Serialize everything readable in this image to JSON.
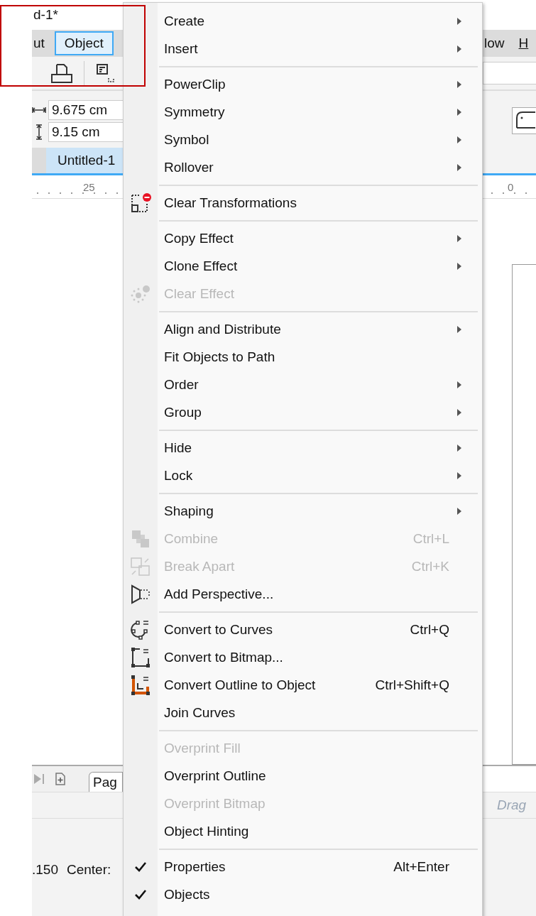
{
  "title_fragment": "d-1*",
  "menubar": {
    "left": [
      {
        "label": "ut",
        "selected": false
      },
      {
        "label": "Object",
        "selected": true
      }
    ],
    "right": [
      {
        "label": "low",
        "selected": false
      },
      {
        "label": "H",
        "selected": false
      }
    ]
  },
  "size_fields": [
    "9.675 cm",
    "9.15 cm"
  ],
  "doc_tabs": [
    {
      "label": "Untitled-1",
      "selected": true
    }
  ],
  "ruler_labels": [
    "25",
    "0"
  ],
  "page_tab": "Pag",
  "hint": "Drag",
  "status": [
    ".150",
    "Center:"
  ],
  "menu": {
    "items": [
      {
        "kind": "item",
        "label": "Create",
        "submenu": true,
        "disabled": false,
        "checked": false
      },
      {
        "kind": "item",
        "label": "Insert",
        "submenu": true,
        "disabled": false,
        "checked": false
      },
      {
        "kind": "separator"
      },
      {
        "kind": "item",
        "label": "PowerClip",
        "submenu": true,
        "disabled": false,
        "checked": false
      },
      {
        "kind": "item",
        "label": "Symmetry",
        "submenu": true,
        "disabled": false,
        "checked": false
      },
      {
        "kind": "item",
        "label": "Symbol",
        "submenu": true,
        "disabled": false,
        "checked": false
      },
      {
        "kind": "item",
        "label": "Rollover",
        "submenu": true,
        "disabled": false,
        "checked": false
      },
      {
        "kind": "separator"
      },
      {
        "kind": "item",
        "label": "Clear Transformations",
        "submenu": false,
        "disabled": false,
        "checked": false
      },
      {
        "kind": "separator"
      },
      {
        "kind": "item",
        "label": "Copy Effect",
        "submenu": true,
        "disabled": false,
        "checked": false
      },
      {
        "kind": "item",
        "label": "Clone Effect",
        "submenu": true,
        "disabled": false,
        "checked": false
      },
      {
        "kind": "item",
        "label": "Clear Effect",
        "submenu": false,
        "disabled": true,
        "checked": false
      },
      {
        "kind": "separator"
      },
      {
        "kind": "item",
        "label": "Align and Distribute",
        "submenu": true,
        "disabled": false,
        "checked": false
      },
      {
        "kind": "item",
        "label": "Fit Objects to Path",
        "submenu": false,
        "disabled": false,
        "checked": false
      },
      {
        "kind": "item",
        "label": "Order",
        "submenu": true,
        "disabled": false,
        "checked": false
      },
      {
        "kind": "item",
        "label": "Group",
        "submenu": true,
        "disabled": false,
        "checked": false
      },
      {
        "kind": "separator"
      },
      {
        "kind": "item",
        "label": "Hide",
        "submenu": true,
        "disabled": false,
        "checked": false
      },
      {
        "kind": "item",
        "label": "Lock",
        "submenu": true,
        "disabled": false,
        "checked": false
      },
      {
        "kind": "separator"
      },
      {
        "kind": "item",
        "label": "Shaping",
        "submenu": true,
        "disabled": false,
        "checked": false
      },
      {
        "kind": "item",
        "label": "Combine",
        "shortcut": "Ctrl+L",
        "submenu": false,
        "disabled": true,
        "checked": false
      },
      {
        "kind": "item",
        "label": "Break Apart",
        "shortcut": "Ctrl+K",
        "submenu": false,
        "disabled": true,
        "checked": false
      },
      {
        "kind": "item",
        "label": "Add Perspective...",
        "submenu": false,
        "disabled": false,
        "checked": false
      },
      {
        "kind": "separator"
      },
      {
        "kind": "item",
        "label": "Convert to Curves",
        "shortcut": "Ctrl+Q",
        "submenu": false,
        "disabled": false,
        "checked": false
      },
      {
        "kind": "item",
        "label": "Convert to Bitmap...",
        "submenu": false,
        "disabled": false,
        "checked": false
      },
      {
        "kind": "item",
        "label": "Convert Outline to Object",
        "shortcut": "Ctrl+Shift+Q",
        "submenu": false,
        "disabled": false,
        "checked": false
      },
      {
        "kind": "item",
        "label": "Join Curves",
        "submenu": false,
        "disabled": false,
        "checked": false
      },
      {
        "kind": "separator"
      },
      {
        "kind": "item",
        "label": "Overprint Fill",
        "submenu": false,
        "disabled": true,
        "checked": false
      },
      {
        "kind": "item",
        "label": "Overprint Outline",
        "submenu": false,
        "disabled": false,
        "checked": false
      },
      {
        "kind": "item",
        "label": "Overprint Bitmap",
        "submenu": false,
        "disabled": true,
        "checked": false
      },
      {
        "kind": "item",
        "label": "Object Hinting",
        "submenu": false,
        "disabled": false,
        "checked": false
      },
      {
        "kind": "separator"
      },
      {
        "kind": "item",
        "label": "Properties",
        "shortcut": "Alt+Enter",
        "submenu": false,
        "disabled": false,
        "checked": true
      },
      {
        "kind": "item",
        "label": "Objects",
        "submenu": false,
        "disabled": false,
        "checked": true
      }
    ]
  }
}
